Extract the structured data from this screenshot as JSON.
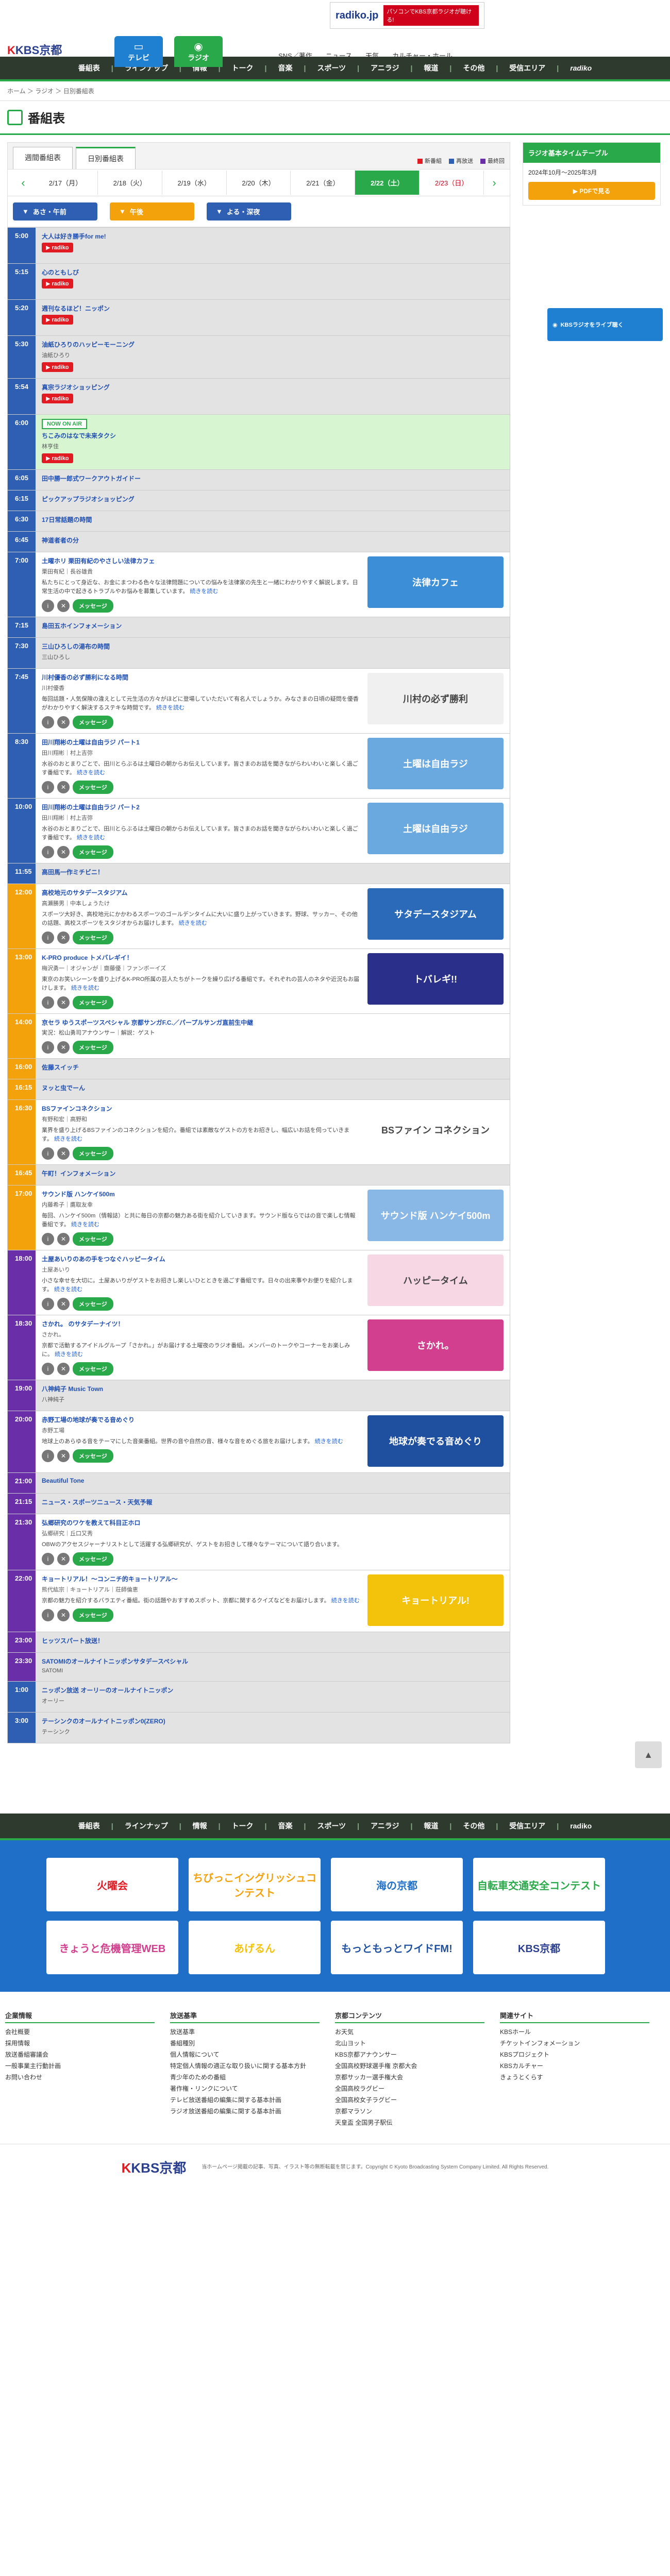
{
  "header": {
    "logo": "KBS京都",
    "tv_label": "テレビ",
    "radio_label": "ラジオ",
    "nav": [
      "SNS／著作",
      "ニュース",
      "天気",
      "カルチャー・ホール"
    ],
    "radiko_banner_logo": "radiko.jp",
    "radiko_banner_text": "パソコンでKBS京都ラジオが聴ける!"
  },
  "global_nav": [
    "番組表",
    "ラインナップ",
    "情報",
    "トーク",
    "音楽",
    "スポーツ",
    "アニラジ",
    "報道",
    "その他",
    "受信エリア",
    "radiko"
  ],
  "breadcrumb": "ホーム ＞ ラジオ ＞ 日別番組表",
  "page_title": "番組表",
  "tabs": [
    "週間番組表",
    "日別番組表"
  ],
  "legend": [
    "新番組",
    "再放送",
    "最終回"
  ],
  "dates": [
    "2/17（月）",
    "2/18（火）",
    "2/19（水）",
    "2/20（木）",
    "2/21（金）",
    "2/22（土）",
    "2/23（日）"
  ],
  "time_filters": [
    "あさ・午前",
    "午後",
    "よる・深夜"
  ],
  "timetable": {
    "title": "ラジオ基本タイムテーブル",
    "period": "2024年10月〜2025年3月",
    "pdf": "PDFで見る"
  },
  "live_button": "KBSラジオをライブ聴く",
  "radiko_label": "radiko",
  "message_label": "メッセージ",
  "onair_label": "NOW ON AIR",
  "more_label": "続きを読む",
  "programs": [
    {
      "time": "5:00",
      "title": "大人は好き勝手for me!",
      "cast": "",
      "desc": "",
      "radiko": true
    },
    {
      "time": "5:15",
      "title": "心のともしび",
      "cast": "",
      "desc": "",
      "radiko": true
    },
    {
      "time": "5:20",
      "title": "週刊なるほど！ニッポン",
      "cast": "",
      "desc": "",
      "radiko": true
    },
    {
      "time": "5:30",
      "title": "油紙ひろりのハッピーモーニング",
      "cast": "油紙ひろり",
      "desc": "",
      "radiko": true
    },
    {
      "time": "5:54",
      "title": "真宗ラジオショッピング",
      "cast": "",
      "desc": "",
      "radiko": true
    },
    {
      "time": "6:00",
      "title": "ちこみのはなで未来タクシ",
      "cast": "林亨佳",
      "desc": "",
      "radiko": true,
      "onair": true
    },
    {
      "time": "6:05",
      "title": "田中勝一郎式ワークアウトガイドー",
      "cast": "",
      "desc": ""
    },
    {
      "time": "6:15",
      "title": "ピックアップラジオショッピング",
      "cast": "",
      "desc": ""
    },
    {
      "time": "6:30",
      "title": "17日常話題の時間",
      "cast": "",
      "desc": ""
    },
    {
      "time": "6:45",
      "title": "神道者者の分",
      "cast": "",
      "desc": ""
    },
    {
      "time": "7:00",
      "title": "土曜ホリ 栗田有紀のやさしい法律カフェ",
      "cast": "栗田有紀｜長谷雄貴",
      "desc": "私たちにとって身近な、お金にまつわる色々な法律問題についての悩みを法律家の先生と一緒にわかりやすく解説します。日常生活の中で起きるトラブルやお悩みを募集しています。",
      "radiko": true,
      "msg": true,
      "thumb": "法律カフェ",
      "thumbColor": "#3c8fd6"
    },
    {
      "time": "7:15",
      "title": "島田五ホインフォメーション",
      "cast": "",
      "desc": ""
    },
    {
      "time": "7:30",
      "title": "三山ひろしの湯布の時間",
      "cast": "三山ひろし",
      "desc": ""
    },
    {
      "time": "7:45",
      "title": "川村優香の必ず勝利になる時間",
      "cast": "川村優香",
      "desc": "毎回話題・人気保険の違えとして元生活の方々がほどに登場していただいて有名人でしょうか。みなさまの日頃の疑問を優香がわかりやすく解決するステキな時間です。",
      "radiko": true,
      "msg": true,
      "thumb": "川村の必ず勝利",
      "thumbColor": "#f0f0f0"
    },
    {
      "time": "8:30",
      "title": "田川翔彬の土曜は自由ラジ パート1",
      "cast": "田川翔彬｜村上吉弥",
      "desc": "水谷のおとまりごとで、田川とらぶるは土曜日の朝からお伝えしています。皆さまのお話を聞きながらわいわいと楽しく過ごす番組です。",
      "radiko": true,
      "msg": true,
      "thumb": "土曜は自由ラジ",
      "thumbColor": "#6aa8e0"
    },
    {
      "time": "10:00",
      "title": "田川翔彬の土曜は自由ラジ パート2",
      "cast": "田川翔彬｜村上吉弥",
      "desc": "水谷のおとまりごとで、田川とらぶるは土曜日の朝からお伝えしています。皆さまのお話を聞きながらわいわいと楽しく過ごす番組です。",
      "radiko": true,
      "msg": true,
      "thumb": "土曜は自由ラジ",
      "thumbColor": "#6aa8e0"
    },
    {
      "time": "11:55",
      "title": "高田馬一作ミチビニ！",
      "cast": "",
      "desc": ""
    },
    {
      "time": "12:00",
      "title": "高校地元のサタデースタジアム",
      "cast": "高瀬勝男｜中本しょうたけ",
      "desc": "スポーツ大好き、高校地元にかかわるスポーツのゴールデンタイムに大いに盛り上がっていきます。野球、サッカー、その他の話題、高校スポーツをスタジオからお届けします。",
      "radiko": true,
      "msg": true,
      "thumb": "サタデースタジアム",
      "thumbColor": "#2a6ab8"
    },
    {
      "time": "13:00",
      "title": "K-PRO produce トメバレギイ！",
      "cast": "梅沢勇一｜オジャンが｜齋藤優｜ファンボーイズ",
      "desc": "東京のお笑いシーンを盛り上げるK-PRO所属の芸人たちがトークを繰り広げる番組です。それぞれの芸人のネタや近況もお届けします。",
      "radiko": true,
      "msg": true,
      "thumb": "トバレギ!!",
      "thumbColor": "#2a2f8a"
    },
    {
      "time": "14:00",
      "title": "京セラ ゆうスポーツスペシャル 京都サンガF.C.／パープルサンガ直前生中継",
      "cast": "",
      "desc": "実況：松山勇司アナウンサー｜解説：ゲスト",
      "radiko": true,
      "msg": true
    },
    {
      "time": "16:00",
      "title": "佐藤スイッチ",
      "cast": "",
      "desc": ""
    },
    {
      "time": "16:15",
      "title": "ヌッと虫でーん",
      "cast": "",
      "desc": ""
    },
    {
      "time": "16:30",
      "title": "BSファインコネクション",
      "cast": "有野和宏｜高野和",
      "desc": "業界を盛り上げるBSファインのコネクションを紹介。番組では素敵なゲストの方をお招きし、幅広いお話を伺っていきます。",
      "radiko": true,
      "msg": true,
      "thumb": "BSファイン コネクション",
      "thumbColor": "#ffffff"
    },
    {
      "time": "16:45",
      "title": "午町！インフォメーション",
      "cast": "",
      "desc": ""
    },
    {
      "time": "17:00",
      "title": "サウンド版 ハンケイ500m",
      "cast": "内藤希子｜鷹取友幸",
      "desc": "毎回、ハンケイ500m（情報誌）と共に毎日の京都の魅力ある街を紹介していきます。サウンド版ならではの音で楽しむ情報番組です。",
      "radiko": true,
      "msg": true,
      "thumb": "サウンド版 ハンケイ500m",
      "thumbColor": "#8ab8e6"
    },
    {
      "time": "18:00",
      "title": "土屋あいりのあの手をつなぐハッピータイム",
      "cast": "土屋あいり",
      "desc": "小さな幸せを大切に。土屋あいりがゲストをお招きし楽しいひとときを過ごす番組です。日々の出来事やお便りを紹介します。",
      "radiko": true,
      "msg": true,
      "thumb": "ハッピータイム",
      "thumbColor": "#f6d7e3"
    },
    {
      "time": "18:30",
      "title": "さかれ。 のサタデーナイツ！",
      "cast": "さかれ。",
      "desc": "京都で活動するアイドルグループ「さかれ。」がお届けする土曜夜のラジオ番組。メンバーのトークやコーナーをお楽しみに。",
      "radiko": true,
      "msg": true,
      "thumb": "さかれ。",
      "thumbColor": "#d23f8f"
    },
    {
      "time": "19:00",
      "title": "八神純子 Music Town",
      "cast": "八神純子",
      "desc": ""
    },
    {
      "time": "20:00",
      "title": "赤野工場の地球が奏でる音めぐり",
      "cast": "赤野工場",
      "desc": "地球上のあらゆる音をテーマにした音楽番組。世界の音や自然の音、様々な音をめぐる旅をお届けします。",
      "radiko": true,
      "msg": true,
      "thumb": "地球が奏でる音めぐり",
      "thumbColor": "#1f4f9f"
    },
    {
      "time": "21:00",
      "title": "Beautiful Tone",
      "cast": "",
      "desc": ""
    },
    {
      "time": "21:15",
      "title": "ニュース・スポーツニュース・天気予報",
      "cast": "",
      "desc": ""
    },
    {
      "time": "21:30",
      "title": "弘郷研究のワケを教えて科目正ホロ",
      "cast": "弘郷研究｜丘口又秀",
      "desc": "OBWのアクセスジャーナリストとして活躍する弘郷研究が、ゲストをお招きして様々なテーマについて語り合います。",
      "radiko": true,
      "msg": true
    },
    {
      "time": "22:00",
      "title": "キョートリアル！～コンニチ的キョートリアル～",
      "cast": "熊代紘宗｜キョートリアル｜荘師倫恵",
      "desc": "京都の魅力を紹介するバラエティ番組。街の話題やおすすめスポット、京都に関するクイズなどをお届けします。",
      "radiko": true,
      "msg": true,
      "thumb": "キョートリアル!",
      "thumbColor": "#f3c20b"
    },
    {
      "time": "23:00",
      "title": "ヒッツスパート放送！",
      "cast": "",
      "desc": ""
    },
    {
      "time": "23:30",
      "title": "SATOMIのオールナイトニッポンサタデースペシャル",
      "cast": "SATOMI",
      "desc": ""
    },
    {
      "time": "1:00",
      "title": "ニッポン放送 オーリーのオールナイトニッポン",
      "cast": "オーリー",
      "desc": ""
    },
    {
      "time": "3:00",
      "title": "テーシンクのオールナイトニッポン0(ZERO)",
      "cast": "テーシンク",
      "desc": ""
    }
  ],
  "footer_banners": [
    "火曜会",
    "ちびっこイングリッシュコンテスト",
    "海の京都",
    "自転車交通安全コンテスト",
    "きょうと危機管理WEB",
    "あげるん",
    "もっともっとワイドFM!",
    "KBS京都"
  ],
  "sitemap": [
    {
      "head": "企業情報",
      "items": [
        "会社概要",
        "採用情報",
        "放送番組審議会",
        "一般事業主行動計画",
        "お問い合わせ"
      ]
    },
    {
      "head": "放送基準",
      "items": [
        "放送基準",
        "番組種別",
        "個人情報について",
        "特定個人情報の適正な取り扱いに関する基本方針",
        "青少年のための番組",
        "著作権・リンクについて",
        "テレビ放送番組の編集に関する基本計画",
        "ラジオ放送番組の編集に関する基本計画"
      ]
    },
    {
      "head": "京都コンテンツ",
      "items": [
        "お天気",
        "北山ヨット",
        "KBS京都アナウンサー",
        "全国高校野球選手権 京都大会",
        "京都サッカー選手権大会",
        "全国高校ラグビー",
        "全国高校女子ラグビー",
        "京都マラソン",
        "天皇盃 全国男子駅伝"
      ]
    },
    {
      "head": "関連サイト",
      "items": [
        "KBSホール",
        "チケットインフォメーション",
        "KBSプロジェクト",
        "KBSカルチャー",
        "きょうとくらす"
      ]
    }
  ],
  "footer_logo": "KBS京都",
  "copyright": "当ホームページ掲載の記事、写真、イラスト等の無断転載を禁じます。Copyright © Kyoto Broadcasting System Company Limited. All Rights Reserved."
}
